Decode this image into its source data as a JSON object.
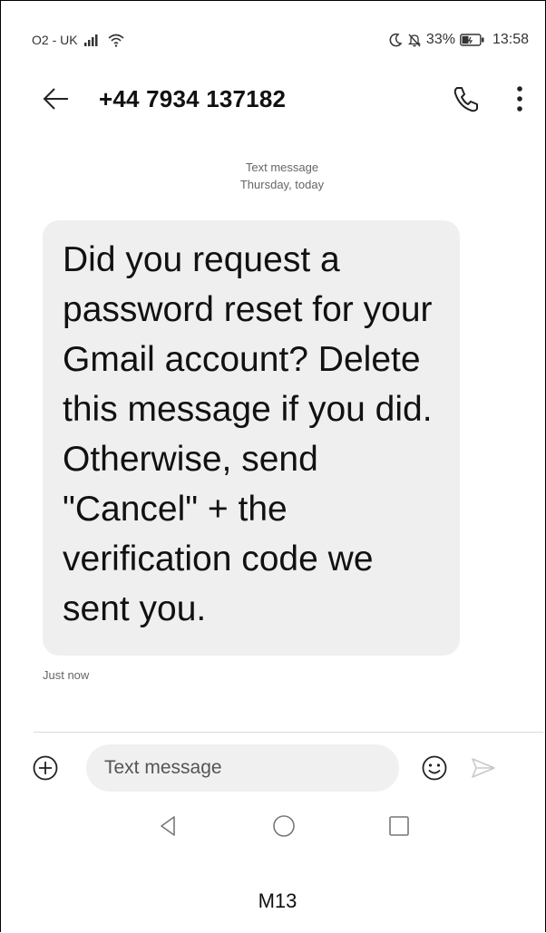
{
  "status_bar": {
    "carrier": "O2 - UK",
    "battery_percent": "33%",
    "time": "13:58",
    "icons": [
      "signal-icon",
      "wifi-icon",
      "moon-icon",
      "bell-off-icon",
      "battery-icon"
    ]
  },
  "header": {
    "contact": "+44 7934 137182",
    "icons": [
      "back-arrow-icon",
      "phone-icon",
      "more-vert-icon"
    ]
  },
  "conversation": {
    "meta_type": "Text message",
    "meta_date": "Thursday, today",
    "message": {
      "text": "Did you request a password reset for your Gmail account? Delete this message if you did. Otherwise, send \"Cancel\" + the verification code we sent you.",
      "timestamp": "Just now"
    }
  },
  "composer": {
    "placeholder": "Text message",
    "value": "",
    "icons": [
      "add-circle-icon",
      "emoji-icon",
      "send-icon"
    ]
  },
  "navbar": {
    "icons": [
      "nav-back-icon",
      "nav-home-icon",
      "nav-recents-icon"
    ]
  },
  "caption": "M13",
  "colors": {
    "bubble_bg": "#efefef",
    "input_bg": "#f0f0f0",
    "muted_text": "#666666",
    "send_disabled": "#c8c8c8"
  }
}
